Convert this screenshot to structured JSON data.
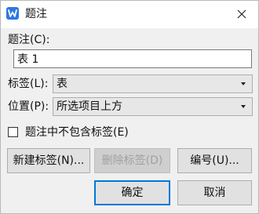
{
  "window": {
    "title": "题注",
    "app_icon_letter": "W",
    "accent_color": "#0078d7",
    "app_icon_color": "#2b78e4"
  },
  "caption": {
    "label": "题注(C):",
    "value": "表 1"
  },
  "label_field": {
    "label": "标签(L):",
    "selected": "表"
  },
  "position_field": {
    "label": "位置(P):",
    "selected": "所选项目上方"
  },
  "exclude_label_checkbox": {
    "label": "题注中不包含标签(E)",
    "checked": false
  },
  "buttons": {
    "new_label": "新建标签(N)...",
    "delete_label": "删除标签(D)",
    "numbering": "编号(U)...",
    "ok": "确定",
    "cancel": "取消"
  }
}
